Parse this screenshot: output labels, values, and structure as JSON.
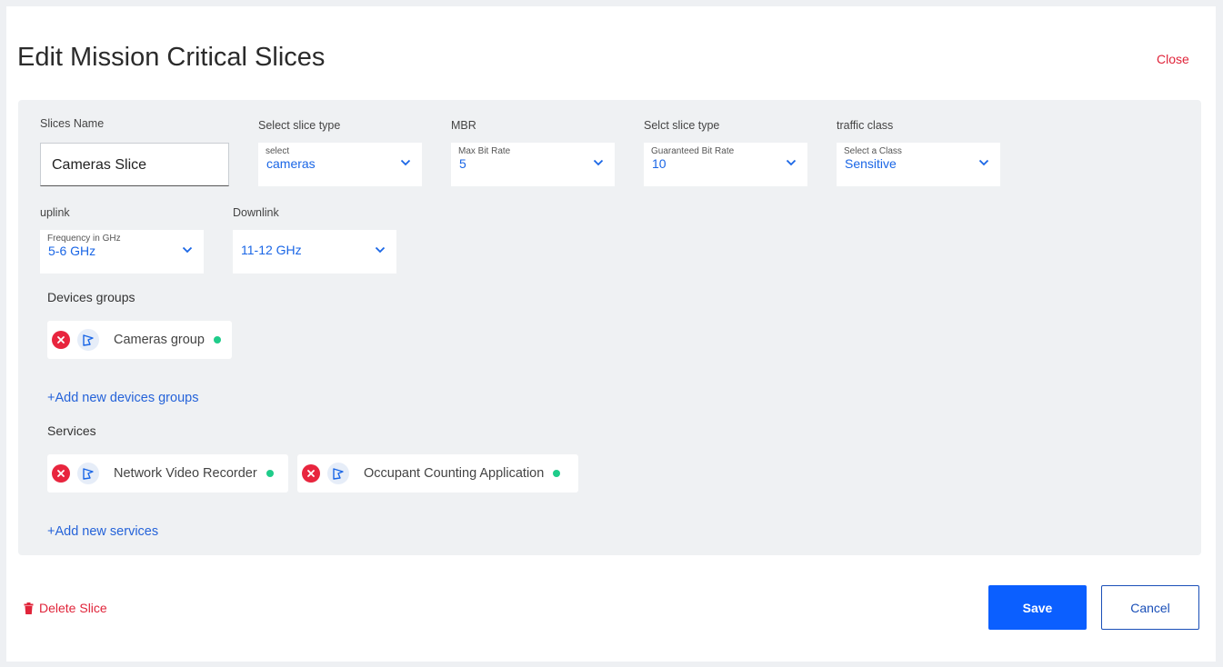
{
  "header": {
    "title": "Edit Mission Critical Slices",
    "close_label": "Close"
  },
  "form": {
    "slice_name": {
      "label": "Slices Name",
      "value": "Cameras Slice"
    },
    "slice_type": {
      "label": "Select slice type",
      "hint": "select",
      "value": "cameras"
    },
    "mbr": {
      "label": "MBR",
      "hint": "Max Bit Rate",
      "value": "5"
    },
    "gbr": {
      "label": "Selct slice type",
      "hint": "Guaranteed Bit Rate",
      "value": "10"
    },
    "traffic_class": {
      "label": "traffic class",
      "hint": "Select a Class",
      "value": "Sensitive"
    },
    "uplink": {
      "label": "uplink",
      "hint": "Frequency in GHz",
      "value": "5-6 GHz"
    },
    "downlink": {
      "label": "Downlink",
      "value": "11-12 GHz"
    }
  },
  "device_groups": {
    "label": "Devices groups",
    "items": [
      {
        "name": "Cameras group"
      }
    ],
    "add_label": "+Add new devices groups"
  },
  "services": {
    "label": "Services",
    "items": [
      {
        "name": "Network Video Recorder"
      },
      {
        "name": "Occupant Counting Application"
      }
    ],
    "add_label": "+Add new services"
  },
  "footer": {
    "delete_label": "Delete Slice",
    "save_label": "Save",
    "cancel_label": "Cancel"
  },
  "colors": {
    "accent": "#0b5fff",
    "danger": "#e0243a",
    "status_ok": "#1fcc8a",
    "select_value": "#1a66e6"
  },
  "icons": {
    "chevron": "chevron-down-icon",
    "remove": "remove-icon",
    "pin": "pin-icon",
    "trash": "trash-icon"
  }
}
